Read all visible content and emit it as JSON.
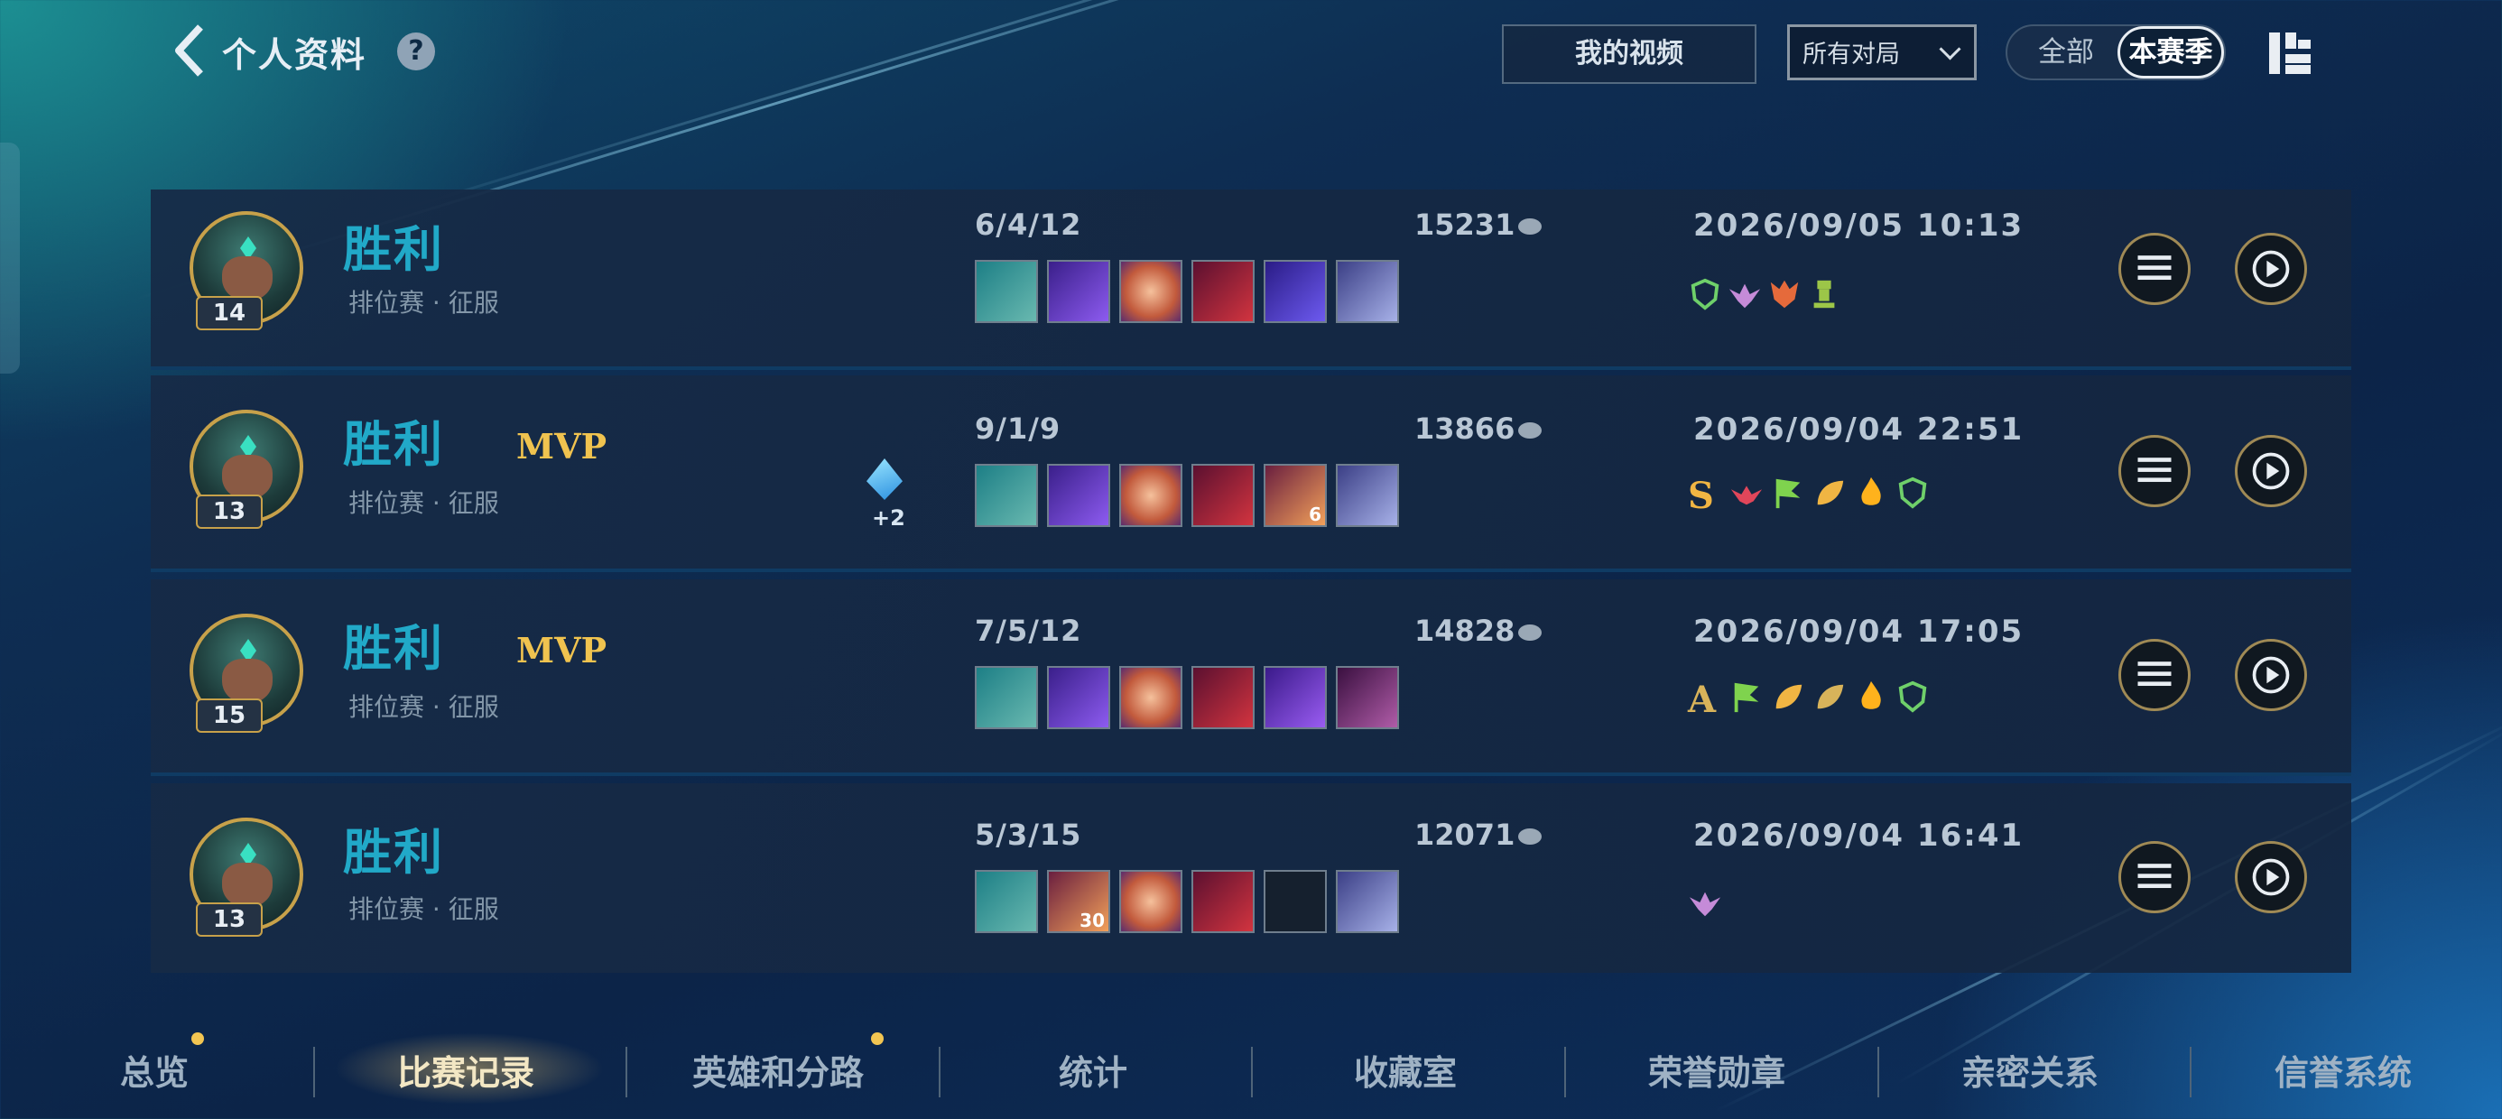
{
  "header": {
    "title": "个人资料",
    "help": "?",
    "my_videos": "我的视频",
    "filter_value": "所有对局",
    "seg_all": "全部",
    "seg_season": "本赛季"
  },
  "matches": [
    {
      "result": "胜利",
      "mode": "排位赛 · 征服",
      "level": "14",
      "mvp": "",
      "kda": "6/4/12",
      "gold": "15231",
      "date": "2026/09/05 10:13"
    },
    {
      "result": "胜利",
      "mode": "排位赛 · 征服",
      "level": "13",
      "mvp": "MVP",
      "kda": "9/1/9",
      "gold": "13866",
      "date": "2026/09/04 22:51",
      "prism": "+2",
      "item_count": "6",
      "grade": "S"
    },
    {
      "result": "胜利",
      "mode": "排位赛 · 征服",
      "level": "15",
      "mvp": "MVP",
      "kda": "7/5/12",
      "gold": "14828",
      "date": "2026/09/04 17:05",
      "grade": "A"
    },
    {
      "result": "胜利",
      "mode": "排位赛 · 征服",
      "level": "13",
      "mvp": "",
      "kda": "5/3/15",
      "gold": "12071",
      "date": "2026/09/04 16:41",
      "item_count": "30"
    }
  ],
  "nav": [
    "总览",
    "比赛记录",
    "英雄和分路",
    "统计",
    "收藏室",
    "荣誉勋章",
    "亲密关系",
    "信誉系统"
  ],
  "colors": {
    "win": "#21a9c8",
    "mvp": "#f0c34f",
    "active_tab": "#f3e7c4"
  }
}
